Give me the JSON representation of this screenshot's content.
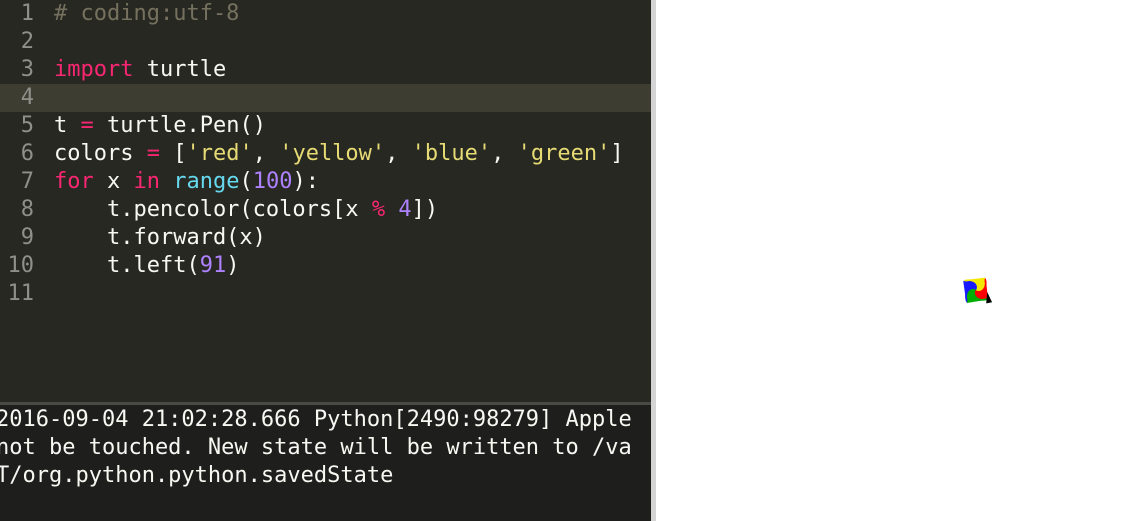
{
  "editor": {
    "lines": [
      {
        "num": "1",
        "tokens": [
          {
            "t": "# coding:utf-8",
            "c": "comment"
          }
        ]
      },
      {
        "num": "2",
        "tokens": []
      },
      {
        "num": "3",
        "tokens": [
          {
            "t": "import",
            "c": "keyword"
          },
          {
            "t": " turtle",
            "c": "plain"
          }
        ]
      },
      {
        "num": "4",
        "tokens": [],
        "current": true
      },
      {
        "num": "5",
        "tokens": [
          {
            "t": "t ",
            "c": "plain"
          },
          {
            "t": "=",
            "c": "op"
          },
          {
            "t": " turtle.Pen()",
            "c": "plain"
          }
        ]
      },
      {
        "num": "6",
        "tokens": [
          {
            "t": "colors ",
            "c": "plain"
          },
          {
            "t": "=",
            "c": "op"
          },
          {
            "t": " [",
            "c": "plain"
          },
          {
            "t": "'red'",
            "c": "string"
          },
          {
            "t": ", ",
            "c": "plain"
          },
          {
            "t": "'yellow'",
            "c": "string"
          },
          {
            "t": ", ",
            "c": "plain"
          },
          {
            "t": "'blue'",
            "c": "string"
          },
          {
            "t": ", ",
            "c": "plain"
          },
          {
            "t": "'green'",
            "c": "string"
          },
          {
            "t": "]",
            "c": "plain"
          }
        ]
      },
      {
        "num": "7",
        "tokens": [
          {
            "t": "for",
            "c": "keyword"
          },
          {
            "t": " x ",
            "c": "plain"
          },
          {
            "t": "in",
            "c": "keyword"
          },
          {
            "t": " ",
            "c": "plain"
          },
          {
            "t": "range",
            "c": "builtin"
          },
          {
            "t": "(",
            "c": "plain"
          },
          {
            "t": "100",
            "c": "number"
          },
          {
            "t": "):",
            "c": "plain"
          }
        ]
      },
      {
        "num": "8",
        "tokens": [
          {
            "t": "    t.pencolor(colors[x ",
            "c": "plain"
          },
          {
            "t": "%",
            "c": "op"
          },
          {
            "t": " ",
            "c": "plain"
          },
          {
            "t": "4",
            "c": "number"
          },
          {
            "t": "])",
            "c": "plain"
          }
        ]
      },
      {
        "num": "9",
        "tokens": [
          {
            "t": "    t.forward(x)",
            "c": "plain"
          }
        ]
      },
      {
        "num": "10",
        "tokens": [
          {
            "t": "    t.left(",
            "c": "plain"
          },
          {
            "t": "91",
            "c": "number"
          },
          {
            "t": ")",
            "c": "plain"
          }
        ]
      },
      {
        "num": "11",
        "tokens": []
      }
    ]
  },
  "console": {
    "lines": [
      "2016-09-04 21:02:28.666 Python[2490:98279] Apple",
      "not be touched. New state will be written to /va",
      "T/org.python.python.savedState"
    ]
  },
  "turtle_drawing": {
    "pen_colors": [
      "red",
      "yellow",
      "blue",
      "green"
    ],
    "steps": 100,
    "turn_angle": 91,
    "colors": {
      "red": "#ff0000",
      "yellow": "#f5e800",
      "blue": "#1a1aff",
      "green": "#00b000",
      "cursor": "#000000"
    }
  },
  "colors": {
    "editor_bg": "#272822",
    "current_line_bg": "#3e3d32",
    "console_bg": "#1e1f1c",
    "canvas_bg": "#ffffff"
  }
}
